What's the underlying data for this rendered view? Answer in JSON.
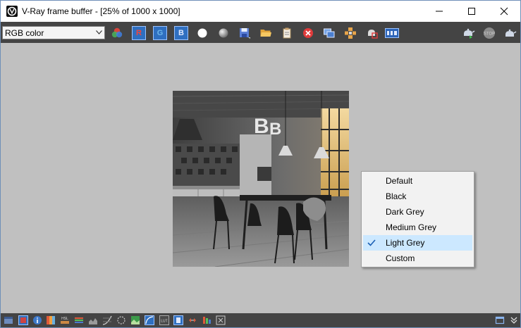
{
  "window": {
    "title": "V-Ray frame buffer - [25% of 1000 x 1000]"
  },
  "toolbar": {
    "channel_select_value": "RGB color",
    "red_channel_label": "R",
    "green_channel_label": "G",
    "blue_channel_label": "B"
  },
  "context_menu": {
    "items": [
      {
        "label": "Default",
        "checked": false
      },
      {
        "label": "Black",
        "checked": false
      },
      {
        "label": "Dark Grey",
        "checked": false
      },
      {
        "label": "Medium Grey",
        "checked": false
      },
      {
        "label": "Light Grey",
        "checked": true
      },
      {
        "label": "Custom",
        "checked": false
      }
    ]
  },
  "colors": {
    "toolbar_bg": "#444444",
    "canvas_bg": "#c0c0c0",
    "channel_button": "#2f6fc0",
    "menu_check_highlight": "#cce8ff"
  },
  "icons": {
    "toolbar": [
      "color-correction-icon",
      "red-channel-icon",
      "green-channel-icon",
      "blue-channel-icon",
      "white-circle-icon",
      "grey-sphere-icon",
      "save-icon",
      "open-folder-icon",
      "clipboard-icon",
      "clear-image-icon",
      "duplicate-icon",
      "track-mouse-icon",
      "render-region-icon",
      "lens-effects-icon",
      "render-teapot-icon",
      "stop-icon",
      "render-interactive-icon"
    ],
    "statusbar": [
      "show-history-icon",
      "color-adjust-icon",
      "info-icon",
      "lut-icon",
      "hsl-icon",
      "levels-icon",
      "histogram-icon",
      "curve-icon",
      "exposure-icon",
      "background-icon",
      "gradient-icon",
      "ocio-icon",
      "lut-file-icon",
      "icc-icon",
      "compare-icon",
      "vertical-split-icon",
      "pixel-info-icon"
    ]
  }
}
